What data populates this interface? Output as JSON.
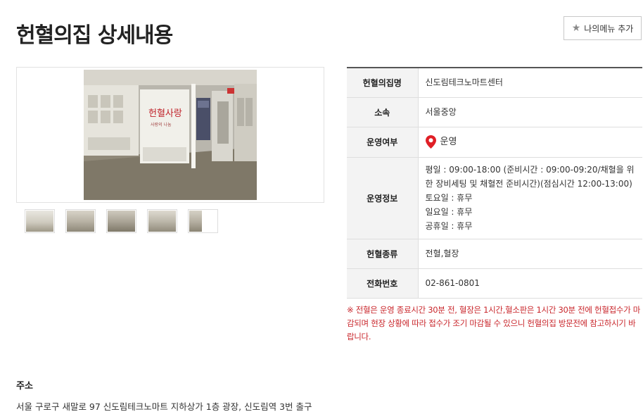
{
  "header": {
    "title": "헌혈의집 상세내용",
    "mymenu_label": "나의메뉴 추가",
    "mymenu_icon": "star-icon"
  },
  "gallery": {
    "main_alt": "신도림테크노마트센터 전경",
    "thumbnail_count": 5
  },
  "info": {
    "rows": [
      {
        "label": "헌혈의집명",
        "value": "신도림테크노마트센터"
      },
      {
        "label": "소속",
        "value": "서울중앙"
      },
      {
        "label": "운영여부",
        "value": "운영",
        "icon": "location-pin-icon",
        "icon_color": "#e01f26"
      },
      {
        "label": "운영정보",
        "lines": [
          "평일 : 09:00-18:00 (준비시간 : 09:00-09:20/채혈을 위한 장비세팅 및 채혈전 준비시간)(점심시간 12:00-13:00)",
          "토요일 : 휴무",
          "일요일 : 휴무",
          "공휴일 : 휴무"
        ]
      },
      {
        "label": "헌혈종류",
        "value": "전혈,혈장"
      },
      {
        "label": "전화번호",
        "value": "02-861-0801"
      }
    ]
  },
  "notice": "※ 전혈은 운영 종료시간 30분 전, 혈장은 1시간,혈소판은 1시간 30분 전에 헌혈접수가 마감되며 현장 상황에 따라 접수가 조기 마감될 수 있으니 헌혈의집 방문전에 참고하시기 바랍니다.",
  "address": {
    "title": "주소",
    "text": "서울 구로구 새말로 97 신도림테크노마트 지하상가 1층 광장, 신도림역 3번 출구"
  },
  "colors": {
    "notice": "#c9262b",
    "table_header_bg": "#f3f3f3",
    "status_pin": "#e01f26"
  }
}
